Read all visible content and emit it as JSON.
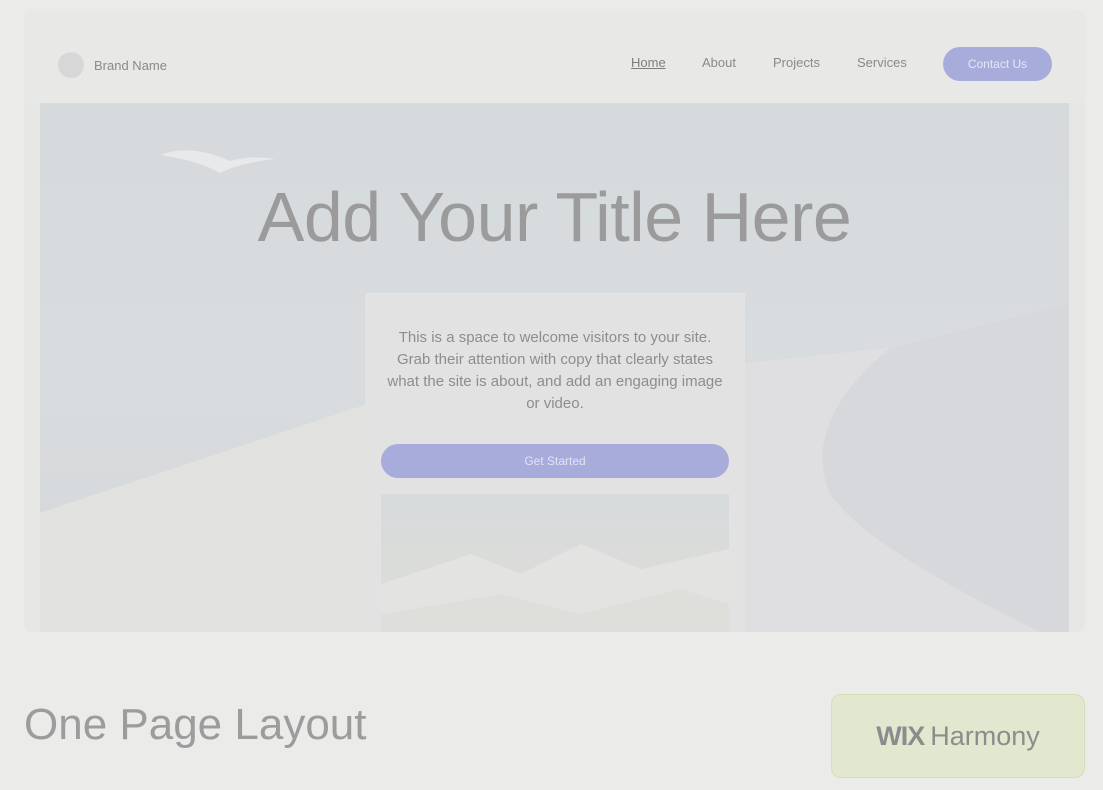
{
  "header": {
    "brand_name": "Brand Name",
    "nav": [
      "Home",
      "About",
      "Projects",
      "Services"
    ],
    "contact_label": "Contact Us"
  },
  "hero": {
    "title": "Add Your Title Here",
    "welcome_text": "This is a space to welcome visitors to your site. Grab their attention with copy that clearly states what the site is about, and add an engaging image or video.",
    "cta_label": "Get Started"
  },
  "footer": {
    "layout_title": "One Page Layout",
    "badge_wix": "WIX",
    "badge_harmony": "Harmony"
  },
  "colors": {
    "accent": "#a8acdb",
    "badge_bg": "#e1e8cf",
    "page_bg": "#ebebea"
  }
}
